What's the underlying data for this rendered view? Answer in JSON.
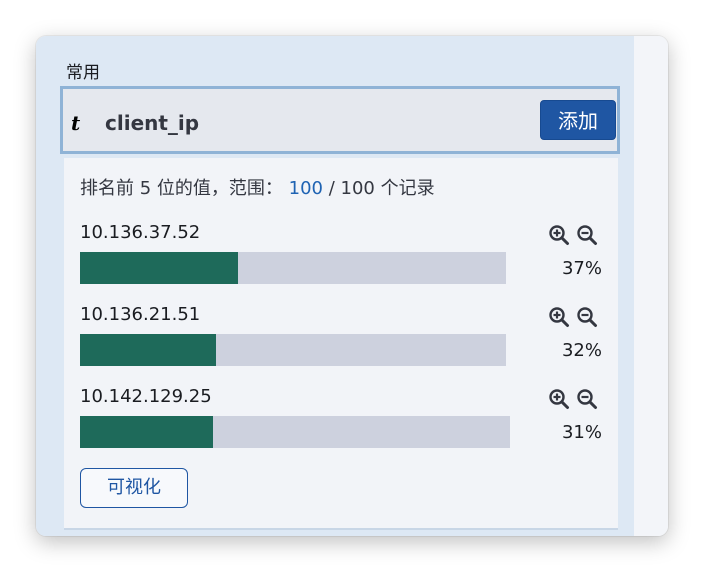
{
  "section": {
    "title": "常用"
  },
  "field": {
    "type_icon": "t",
    "name": "client_ip",
    "add_label": "添加"
  },
  "summary": {
    "prefix": "排名前 5 位的值，范围：",
    "count": "100",
    "suffix": "/ 100 个记录"
  },
  "values": [
    {
      "label": "10.136.37.52",
      "percent_text": "37%",
      "fraction": 0.37
    },
    {
      "label": "10.136.21.51",
      "percent_text": "32%",
      "fraction": 0.32
    },
    {
      "label": "10.142.129.25",
      "percent_text": "31%",
      "fraction": 0.31
    }
  ],
  "icons": {
    "filter_for": "zoom-in-icon",
    "filter_out": "zoom-out-icon"
  },
  "colors": {
    "bar_fill": "#1e6a5a",
    "bar_track": "#cdd1de",
    "accent": "#1f56a3"
  },
  "visualize": {
    "label": "可视化"
  }
}
